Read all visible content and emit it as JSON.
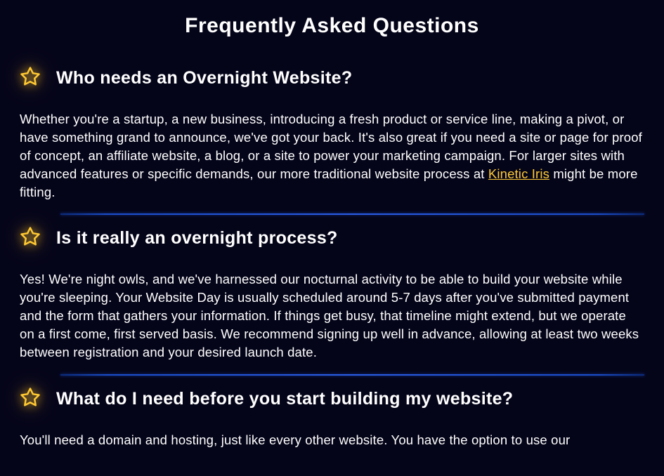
{
  "page": {
    "title": "Frequently Asked Questions"
  },
  "faqs": [
    {
      "question": "Who needs an Overnight Website?",
      "answer_pre": "Whether you're a startup, a new business, introducing a fresh product or service line, making a pivot, or have something grand to announce, we've got your back. It's also great if you need a site or page for proof of concept, an affiliate website, a blog, or a site to power your marketing campaign. For larger sites with advanced features or specific demands, our more traditional website process at ",
      "link_text": "Kinetic Iris",
      "answer_post": " might be more fitting."
    },
    {
      "question": "Is it really an overnight process?",
      "answer": "Yes! We're night owls, and we've harnessed our nocturnal activity to be able to build your website while you're sleeping. Your Website Day is usually scheduled around 5-7 days after you've submitted payment and the form that gathers your information. If things get busy, that timeline might extend, but we operate on a first come, first served basis. We recommend signing up well in advance, allowing at least two weeks between registration and your desired launch date."
    },
    {
      "question": "What do I need before you start building my website?",
      "answer": "You'll need a domain and hosting, just like every other website. You have the option to use our"
    }
  ],
  "icons": {
    "star": "star-icon"
  },
  "colors": {
    "background": "#05051a",
    "text": "#ffffff",
    "accent": "#ffc933",
    "divider": "#2a5de8"
  }
}
